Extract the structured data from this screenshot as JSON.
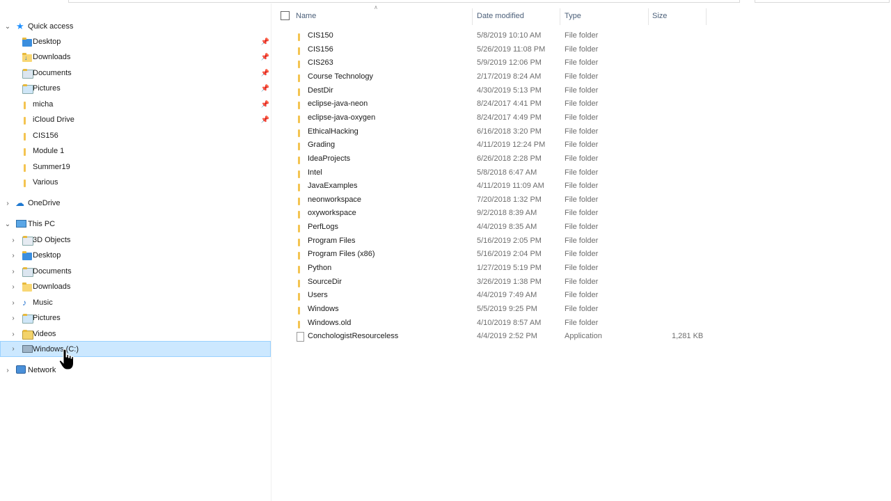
{
  "nav": {
    "quick_access": {
      "label": "Quick access",
      "items": [
        {
          "label": "Desktop",
          "icon": "desktop-folder-icon",
          "pinned": true
        },
        {
          "label": "Downloads",
          "icon": "downloads-folder-icon",
          "pinned": true
        },
        {
          "label": "Documents",
          "icon": "documents-folder-icon",
          "pinned": true
        },
        {
          "label": "Pictures",
          "icon": "pictures-folder-icon",
          "pinned": true
        },
        {
          "label": "micha",
          "icon": "folder-icon",
          "pinned": true
        },
        {
          "label": "iCloud Drive",
          "icon": "folder-icon",
          "pinned": true
        },
        {
          "label": "CIS156",
          "icon": "folder-icon",
          "pinned": false
        },
        {
          "label": "Module 1",
          "icon": "folder-icon",
          "pinned": false
        },
        {
          "label": "Summer19",
          "icon": "folder-icon",
          "pinned": false
        },
        {
          "label": "Various",
          "icon": "folder-icon",
          "pinned": false
        }
      ]
    },
    "onedrive": {
      "label": "OneDrive"
    },
    "this_pc": {
      "label": "This PC",
      "items": [
        {
          "label": "3D Objects"
        },
        {
          "label": "Desktop"
        },
        {
          "label": "Documents"
        },
        {
          "label": "Downloads"
        },
        {
          "label": "Music"
        },
        {
          "label": "Pictures"
        },
        {
          "label": "Videos"
        },
        {
          "label": "Windows (C:)",
          "selected": true
        }
      ]
    },
    "network": {
      "label": "Network"
    }
  },
  "columns": {
    "name": "Name",
    "date": "Date modified",
    "type": "Type",
    "size": "Size"
  },
  "files": [
    {
      "name": "CIS150",
      "date": "5/8/2019 10:10 AM",
      "type": "File folder",
      "size": ""
    },
    {
      "name": "CIS156",
      "date": "5/26/2019 11:08 PM",
      "type": "File folder",
      "size": ""
    },
    {
      "name": "CIS263",
      "date": "5/9/2019 12:06 PM",
      "type": "File folder",
      "size": ""
    },
    {
      "name": "Course Technology",
      "date": "2/17/2019 8:24 AM",
      "type": "File folder",
      "size": ""
    },
    {
      "name": "DestDir",
      "date": "4/30/2019 5:13 PM",
      "type": "File folder",
      "size": ""
    },
    {
      "name": "eclipse-java-neon",
      "date": "8/24/2017 4:41 PM",
      "type": "File folder",
      "size": ""
    },
    {
      "name": "eclipse-java-oxygen",
      "date": "8/24/2017 4:49 PM",
      "type": "File folder",
      "size": ""
    },
    {
      "name": "EthicalHacking",
      "date": "6/16/2018 3:20 PM",
      "type": "File folder",
      "size": ""
    },
    {
      "name": "Grading",
      "date": "4/11/2019 12:24 PM",
      "type": "File folder",
      "size": ""
    },
    {
      "name": "IdeaProjects",
      "date": "6/26/2018 2:28 PM",
      "type": "File folder",
      "size": ""
    },
    {
      "name": "Intel",
      "date": "5/8/2018 6:47 AM",
      "type": "File folder",
      "size": ""
    },
    {
      "name": "JavaExamples",
      "date": "4/11/2019 11:09 AM",
      "type": "File folder",
      "size": ""
    },
    {
      "name": "neonworkspace",
      "date": "7/20/2018 1:32 PM",
      "type": "File folder",
      "size": ""
    },
    {
      "name": "oxyworkspace",
      "date": "9/2/2018 8:39 AM",
      "type": "File folder",
      "size": ""
    },
    {
      "name": "PerfLogs",
      "date": "4/4/2019 8:35 AM",
      "type": "File folder",
      "size": ""
    },
    {
      "name": "Program Files",
      "date": "5/16/2019 2:05 PM",
      "type": "File folder",
      "size": ""
    },
    {
      "name": "Program Files (x86)",
      "date": "5/16/2019 2:04 PM",
      "type": "File folder",
      "size": ""
    },
    {
      "name": "Python",
      "date": "1/27/2019 5:19 PM",
      "type": "File folder",
      "size": ""
    },
    {
      "name": "SourceDir",
      "date": "3/26/2019 1:38 PM",
      "type": "File folder",
      "size": ""
    },
    {
      "name": "Users",
      "date": "4/4/2019 7:49 AM",
      "type": "File folder",
      "size": ""
    },
    {
      "name": "Windows",
      "date": "5/5/2019 9:25 PM",
      "type": "File folder",
      "size": ""
    },
    {
      "name": "Windows.old",
      "date": "4/10/2019 8:57 AM",
      "type": "File folder",
      "size": ""
    },
    {
      "name": "ConchologistResourceless",
      "date": "4/4/2019 2:52 PM",
      "type": "Application",
      "size": "1,281 KB"
    }
  ],
  "colors": {
    "selection": "#cce8ff",
    "selection_border": "#99d1ff",
    "header_text": "#4c607a",
    "folder": "#f8d775"
  }
}
